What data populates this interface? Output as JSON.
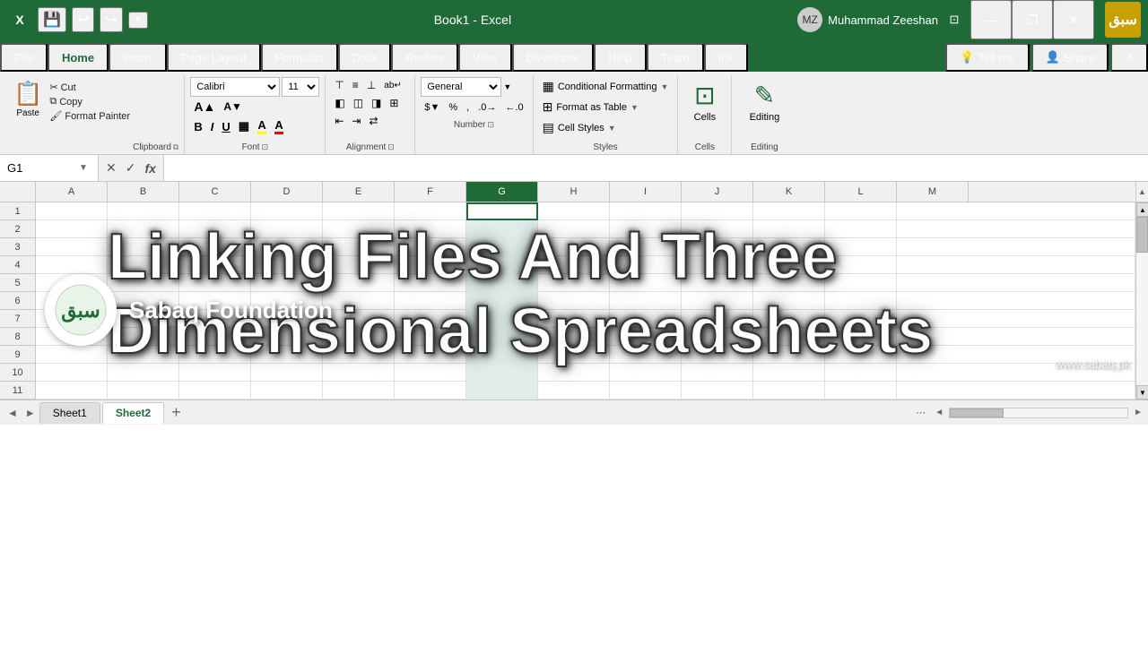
{
  "titleBar": {
    "title": "Book1 - Excel",
    "user": "Muhammad Zeeshan",
    "saveBtn": "💾",
    "undoBtn": "↩",
    "redoBtn": "↪",
    "customizeBtn": "▼",
    "minimizeBtn": "—",
    "restoreBtn": "❐",
    "closeBtn": "✕",
    "profileBtn": "👤",
    "windowBtn": "⊡"
  },
  "tabs": {
    "items": [
      {
        "label": "File",
        "active": false
      },
      {
        "label": "Home",
        "active": true
      },
      {
        "label": "Insert",
        "active": false
      },
      {
        "label": "Page Layout",
        "active": false
      },
      {
        "label": "Formulas",
        "active": false
      },
      {
        "label": "Data",
        "active": false
      },
      {
        "label": "Review",
        "active": false
      },
      {
        "label": "View",
        "active": false
      },
      {
        "label": "Developer",
        "active": false
      },
      {
        "label": "Help",
        "active": false
      },
      {
        "label": "Team",
        "active": false
      },
      {
        "label": "Ink",
        "active": false
      }
    ],
    "tellMeLabel": "Tell me",
    "shareLabel": "Share"
  },
  "ribbon": {
    "clipboard": {
      "label": "Clipboard",
      "pasteLabel": "Paste",
      "cutLabel": "Cut",
      "copyLabel": "Copy",
      "formatPainterLabel": "Format Painter"
    },
    "font": {
      "label": "Font",
      "fontName": "Calibri",
      "fontSize": "11",
      "boldLabel": "B",
      "italicLabel": "I",
      "underlineLabel": "U",
      "increaseSizeLabel": "A",
      "decreaseSizeLabel": "A"
    },
    "alignment": {
      "label": "Alignment",
      "topAlignLabel": "⊤",
      "middleAlignLabel": "≡",
      "bottomAlignLabel": "⊥",
      "leftAlignLabel": "≡",
      "centerAlignLabel": "≡",
      "rightAlignLabel": "≡",
      "wrapTextLabel": "ab↵",
      "mergeLabel": "⊞"
    },
    "number": {
      "label": "Number",
      "formatLabel": "General",
      "currencyLabel": "$",
      "percentLabel": "%",
      "commaLabel": ","
    },
    "styles": {
      "label": "Styles",
      "conditionalFormattingLabel": "Conditional Formatting",
      "formatAsTableLabel": "Format as Table",
      "cellStylesLabel": "Cell Styles"
    },
    "cells": {
      "label": "Cells",
      "cellsLabel": "Cells"
    },
    "editing": {
      "label": "Editing",
      "editingLabel": "Editing"
    }
  },
  "formulaBar": {
    "cellName": "G1",
    "cancelBtn": "✕",
    "confirmBtn": "✓",
    "fxLabel": "fx",
    "formula": ""
  },
  "grid": {
    "columns": [
      "A",
      "B",
      "C",
      "D",
      "E",
      "F",
      "G",
      "H",
      "I",
      "J",
      "K",
      "L",
      "M"
    ],
    "rows": [
      1,
      2,
      3,
      4,
      5,
      6,
      7,
      8,
      9,
      10,
      11
    ],
    "selectedCell": "G1"
  },
  "overlayText": {
    "line1": "Linking Files And Three",
    "line2": "Dimensional Spreadsheets"
  },
  "logo": {
    "emoji": "📚",
    "text": "Sabaq Foundation",
    "website": "www.sabaq.pk"
  },
  "sheets": {
    "tabs": [
      {
        "label": "Sheet1",
        "active": false
      },
      {
        "label": "Sheet2",
        "active": true
      }
    ],
    "addLabel": "+"
  },
  "brandLogo": {
    "text": "سبق"
  }
}
